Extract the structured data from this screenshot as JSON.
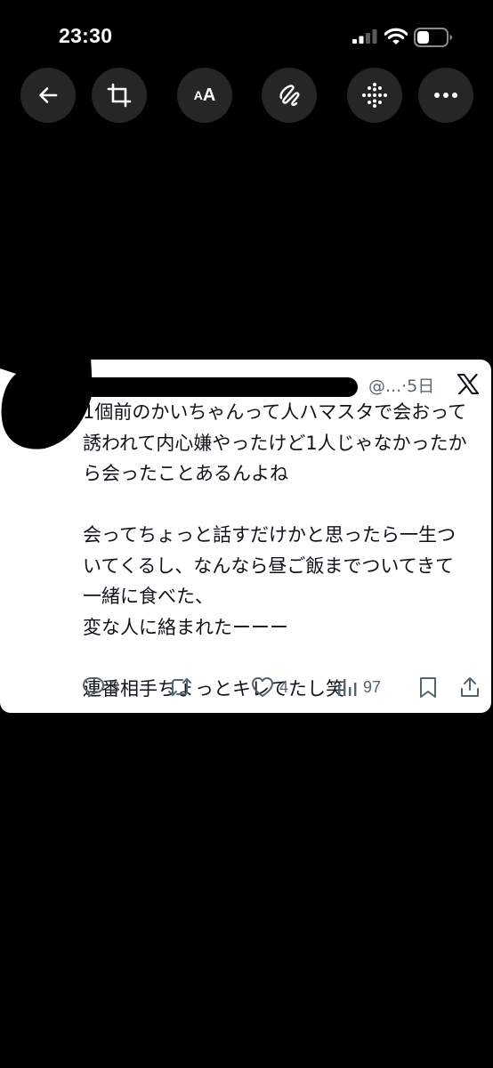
{
  "status_bar": {
    "time": "23:30"
  },
  "toolbar": {
    "back_icon": "arrow-left-icon",
    "crop_icon": "crop-icon",
    "text_size_label_small": "A",
    "text_size_label_big": "A",
    "markup_icon": "pen-scribble-icon",
    "grid_icon": "dot-grid-icon",
    "more_icon": "ellipsis-icon"
  },
  "tweet": {
    "handle_suffix": "@...",
    "separator": "·",
    "time": "5日",
    "lines": [
      "1個前のかいちゃんって人ハマスタで会おって",
      "誘われて内心嫌やったけど1人じゃなかったか",
      "ら会ったことあるんよね",
      "",
      "会ってちょっと話すだけかと思ったら一生つ",
      "いてくるし、なんなら昼ご飯までついてきて",
      "一緒に食べた、",
      "変な人に絡まれたーーー",
      "",
      "連番相手ちょっとキレてたし笑"
    ],
    "actions": {
      "replies": "3",
      "likes": "4",
      "views": "97"
    }
  },
  "colors": {
    "background": "#000000",
    "button_bg": "#262626",
    "card_bg": "#ffffff",
    "text": "#0f1419",
    "muted": "#536471"
  }
}
